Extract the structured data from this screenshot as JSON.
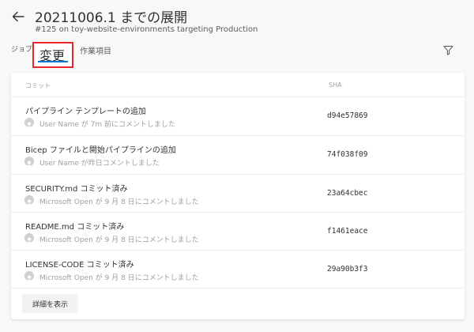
{
  "header": {
    "title": "20211006.1 までの展開",
    "subtitle": "#125 on toy-website-environments targeting Production"
  },
  "tabs": {
    "jobs": "ジョブ",
    "changes": "変更",
    "work_items": "作業項目"
  },
  "table": {
    "columns": {
      "commit": "コミット",
      "sha": "SHA"
    },
    "rows": [
      {
        "message": "パイプライン テンプレートの追加",
        "meta": "User Name が 7m 前にコメントしました",
        "sha": "d94e57869"
      },
      {
        "message": "Bicep ファイルと開始パイプラインの追加",
        "meta": "User Name が昨日コメントしました",
        "sha": "74f038f09"
      },
      {
        "message": "SECURITY.md コミット済み",
        "meta": "Microsoft Open が 9 月 8 日にコメントしました",
        "sha": "23a64cbec"
      },
      {
        "message": "README.md コミット済み",
        "meta": "Microsoft Open が 9 月 8 日にコメントしました",
        "sha": "f1461eace"
      },
      {
        "message": "LICENSE-CODE コミット済み",
        "meta": "Microsoft Open が 9 月 8 日にコメントしました",
        "sha": "29a90b3f3"
      }
    ]
  },
  "actions": {
    "show_more": "詳細を表示"
  },
  "colors": {
    "accent": "#0078d4",
    "highlight_box": "#e8272b"
  },
  "icons": {
    "back": "arrow-left",
    "filter": "funnel",
    "avatar": "person-silhouette"
  }
}
